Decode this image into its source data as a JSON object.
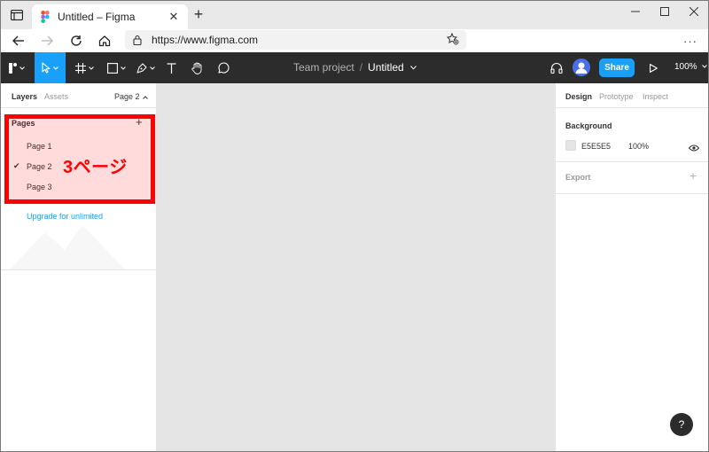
{
  "browser": {
    "tab_title": "Untitled – Figma",
    "tab_close": "✕",
    "new_tab": "+",
    "url": "https://www.figma.com",
    "more_menu": "···"
  },
  "toolbar": {
    "project": "Team project",
    "separator": "/",
    "file_name": "Untitled",
    "share_label": "Share",
    "zoom": "100%",
    "accent": "#18a0fb",
    "background": "#2c2c2c"
  },
  "left_panel": {
    "tabs": [
      "Layers",
      "Assets"
    ],
    "current_page": "Page 2",
    "pages_title": "Pages",
    "add_symbol": "+",
    "pages": [
      {
        "label": "Page 1",
        "selected": false
      },
      {
        "label": "Page 2",
        "selected": true
      },
      {
        "label": "Page 3",
        "selected": false
      }
    ],
    "checkmark": "✔",
    "upgrade_link": "Upgrade for unlimited"
  },
  "annotation": {
    "callout_text": "3ページ",
    "color": "#ff0000"
  },
  "canvas": {
    "background": "#e5e5e5"
  },
  "right_panel": {
    "tabs": [
      "Design",
      "Prototype",
      "Inspect"
    ],
    "background_title": "Background",
    "background_hex": "E5E5E5",
    "background_opacity": "100%",
    "export_title": "Export",
    "add_symbol": "+"
  },
  "help_label": "?"
}
